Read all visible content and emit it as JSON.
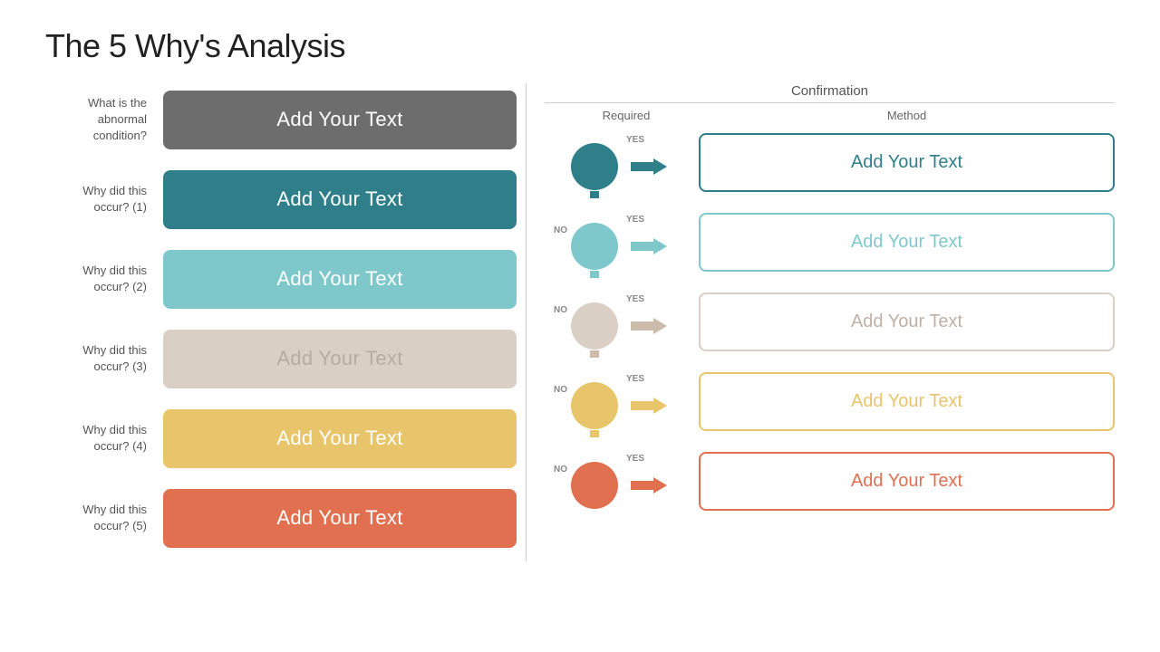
{
  "title": "The 5 Why's Analysis",
  "left": {
    "rows": [
      {
        "label": "What is the\nabnormal\ncondition?",
        "text": "Add Your Text",
        "style": "gray"
      },
      {
        "label": "Why did this\noccur? (1)",
        "text": "Add Your Text",
        "style": "teal-dark"
      },
      {
        "label": "Why did this\noccur? (2)",
        "text": "Add Your Text",
        "style": "teal-light"
      },
      {
        "label": "Why did this\noccur? (3)",
        "text": "Add Your Text",
        "style": "beige"
      },
      {
        "label": "Why did this\noccur? (4)",
        "text": "Add Your Text",
        "style": "yellow"
      },
      {
        "label": "Why did this\noccur? (5)",
        "text": "Add Your Text",
        "style": "orange"
      }
    ]
  },
  "right": {
    "title": "Confirmation",
    "col_required": "Required",
    "col_method": "Method",
    "rows": [
      {
        "text": "Add Your Text",
        "style": "teal-dark",
        "circle_color": "#2e7f8a",
        "arrow_color": "#2e7f8a"
      },
      {
        "text": "Add Your Text",
        "style": "teal-light",
        "circle_color": "#7ec8cc",
        "arrow_color": "#7ec8cc"
      },
      {
        "text": "Add Your Text",
        "style": "beige",
        "circle_color": "#d9cfc4",
        "arrow_color": "#ccbbaa"
      },
      {
        "text": "Add Your Text",
        "style": "yellow",
        "circle_color": "#e8c46a",
        "arrow_color": "#e8c46a"
      },
      {
        "text": "Add Your Text",
        "style": "orange",
        "circle_color": "#e07050",
        "arrow_color": "#e07050"
      }
    ]
  }
}
